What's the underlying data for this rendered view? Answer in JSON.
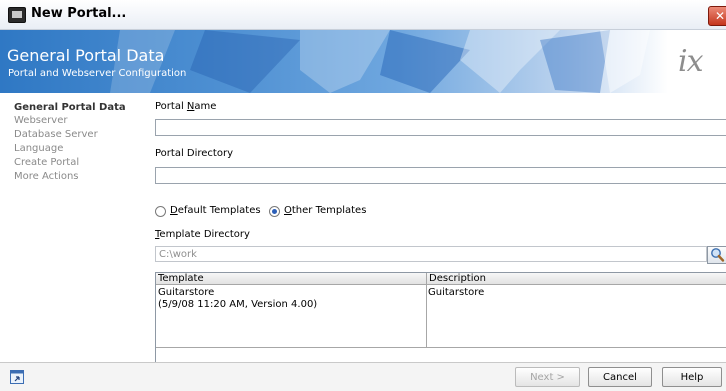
{
  "window": {
    "title": "New Portal..."
  },
  "banner": {
    "title": "General Portal Data",
    "subtitle": "Portal and Webserver Configuration",
    "logo": "ix"
  },
  "steps": [
    {
      "label": "General Portal Data",
      "active": true
    },
    {
      "label": "Webserver",
      "active": false
    },
    {
      "label": "Database Server",
      "active": false
    },
    {
      "label": "Language",
      "active": false
    },
    {
      "label": "Create Portal",
      "active": false
    },
    {
      "label": "More Actions",
      "active": false
    }
  ],
  "form": {
    "portal_name_label_pre": "Portal ",
    "portal_name_label_mn": "N",
    "portal_name_label_post": "ame",
    "portal_name_value": "",
    "portal_directory_label": "Portal Directory",
    "portal_directory_value": "",
    "default_templates_mn": "D",
    "default_templates_rest": "efault Templates",
    "other_templates_mn": "O",
    "other_templates_rest": "ther Templates",
    "selected_template_source": "Other Templates",
    "template_directory_mn": "T",
    "template_directory_rest": "emplate Directory",
    "template_directory_value": "C:\\work"
  },
  "table": {
    "columns": [
      "Template",
      "Description"
    ],
    "rows": [
      {
        "template_line1": "Guitarstore",
        "template_line2": "(5/9/08 11:20 AM, Version 4.00)",
        "description": "Guitarstore"
      }
    ]
  },
  "buttons": {
    "next": "Next >",
    "cancel": "Cancel",
    "help": "Help"
  },
  "icons": {
    "app": "app-window-icon",
    "close": "close-icon",
    "browse": "magnifier-icon",
    "bottom_left": "window-restore-icon"
  }
}
